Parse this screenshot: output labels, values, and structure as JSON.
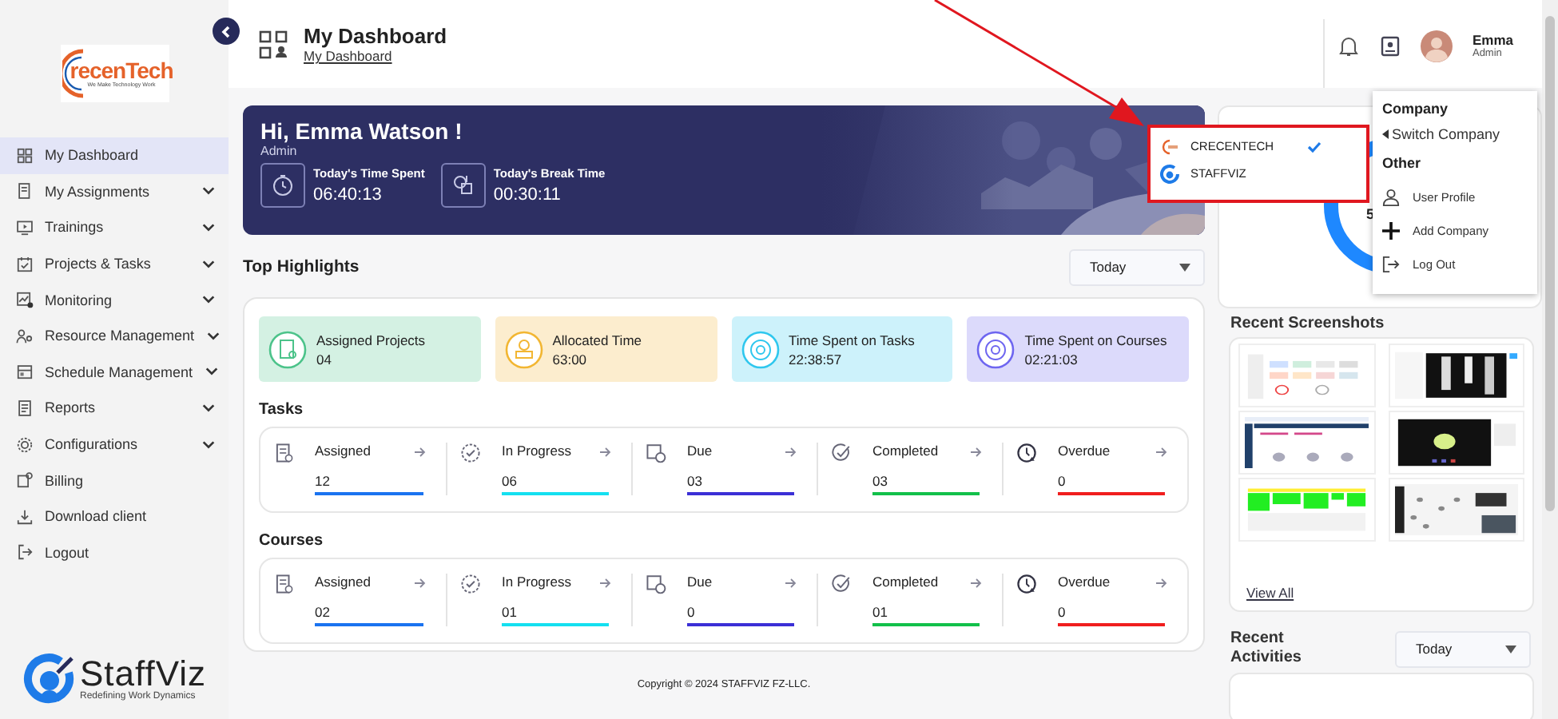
{
  "sidebar": {
    "logo": {
      "text": "recenTech",
      "tagline": "We Make Technology Work"
    },
    "items": [
      {
        "label": "My Dashboard",
        "selected": true,
        "expandable": false
      },
      {
        "label": "My Assignments",
        "selected": false,
        "expandable": true
      },
      {
        "label": "Trainings",
        "selected": false,
        "expandable": true
      },
      {
        "label": "Projects & Tasks",
        "selected": false,
        "expandable": true
      },
      {
        "label": "Monitoring",
        "selected": false,
        "expandable": true
      },
      {
        "label": "Resource Management",
        "selected": false,
        "expandable": true
      },
      {
        "label": "Schedule Management",
        "selected": false,
        "expandable": true
      },
      {
        "label": "Reports",
        "selected": false,
        "expandable": true
      },
      {
        "label": "Configurations",
        "selected": false,
        "expandable": true
      },
      {
        "label": "Billing",
        "selected": false,
        "expandable": false
      },
      {
        "label": "Download client",
        "selected": false,
        "expandable": false
      },
      {
        "label": "Logout",
        "selected": false,
        "expandable": false
      }
    ],
    "brand": {
      "name": "StaffViz",
      "tagline": "Redefining Work Dynamics"
    }
  },
  "header": {
    "title": "My Dashboard",
    "breadcrumb": "My Dashboard",
    "user": {
      "name": "Emma",
      "role": "Admin"
    }
  },
  "banner": {
    "greeting": "Hi, Emma Watson !",
    "role": "Admin",
    "stats": [
      {
        "label": "Today's Time Spent",
        "value": "06:40:13"
      },
      {
        "label": "Today's Break Time",
        "value": "00:30:11"
      }
    ]
  },
  "highlights": {
    "title": "Top Highlights",
    "period": "Today",
    "cards": [
      {
        "label": "Assigned Projects",
        "value": "04",
        "color": "#4cc38a"
      },
      {
        "label": "Allocated Time",
        "value": "63:00",
        "color": "#f2b632"
      },
      {
        "label": "Time Spent on Tasks",
        "value": "22:38:57",
        "color": "#2fc7ee"
      },
      {
        "label": "Time Spent on Courses",
        "value": "02:21:03",
        "color": "#6e66f0"
      }
    ],
    "sections": [
      {
        "title": "Tasks",
        "items": [
          {
            "label": "Assigned",
            "value": "12",
            "color": "#1a73f0"
          },
          {
            "label": "In Progress",
            "value": "06",
            "color": "#14e0f0"
          },
          {
            "label": "Due",
            "value": "03",
            "color": "#3b2fd6"
          },
          {
            "label": "Completed",
            "value": "03",
            "color": "#12c04a"
          },
          {
            "label": "Overdue",
            "value": "0",
            "color": "#f01e1e"
          }
        ]
      },
      {
        "title": "Courses",
        "items": [
          {
            "label": "Assigned",
            "value": "02",
            "color": "#1a73f0"
          },
          {
            "label": "In Progress",
            "value": "01",
            "color": "#14e0f0"
          },
          {
            "label": "Due",
            "value": "0",
            "color": "#3b2fd6"
          },
          {
            "label": "Completed",
            "value": "01",
            "color": "#12c04a"
          },
          {
            "label": "Overdue",
            "value": "0",
            "color": "#f01e1e"
          }
        ]
      }
    ]
  },
  "footer": "Copyright © 2024 STAFFVIZ FZ-LLC.",
  "side_panel": {
    "donut_label": "5",
    "screenshots": {
      "title": "Recent Screenshots",
      "link": "View All"
    },
    "activities": {
      "title": "Recent Activities",
      "period": "Today"
    }
  },
  "company_popup": {
    "companies": [
      {
        "name": "CRECENTECH",
        "selected": true
      },
      {
        "name": "STAFFVIZ",
        "selected": false
      }
    ]
  },
  "account_menu": {
    "company_heading": "Company",
    "switch_label": "Switch Company",
    "other_heading": "Other",
    "items": [
      "User Profile",
      "Add Company",
      "Log Out"
    ]
  }
}
